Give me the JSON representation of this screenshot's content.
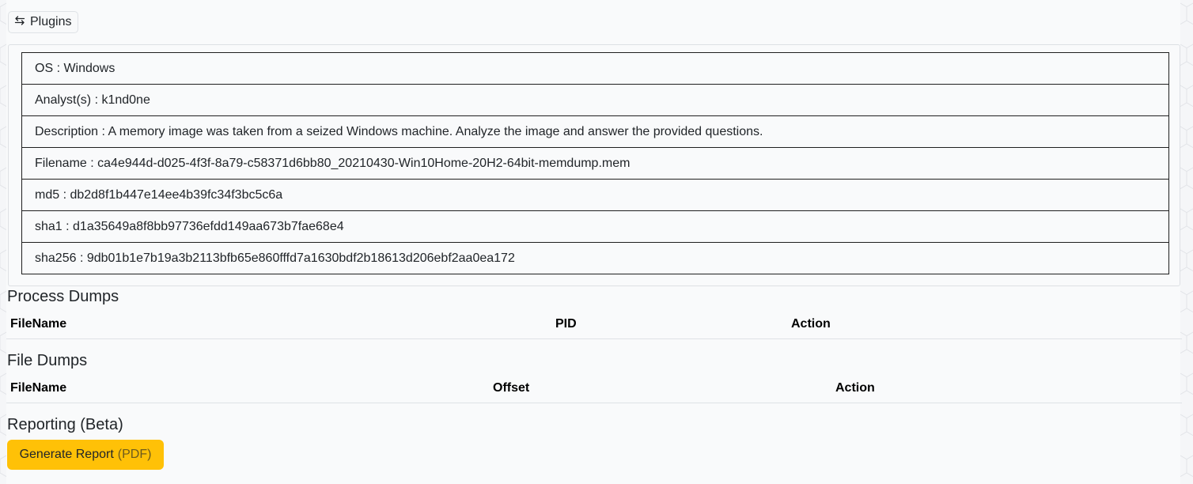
{
  "colors": {
    "page_bg": "#f5f6f8",
    "panel_bg": "#f9fafb",
    "report_button": "#ffc107",
    "table_border": "#1f1f1f"
  },
  "toolbar": {
    "plugins_icon": "swap-arrows-icon",
    "plugins_label": "Plugins"
  },
  "info": {
    "os": "OS : Windows",
    "analysts": "Analyst(s) : k1nd0ne",
    "description": "Description : A memory image was taken from a seized Windows machine. Analyze the image and answer the provided questions.",
    "filename": "Filename : ca4e944d-d025-4f3f-8a79-c58371d6bb80_20210430-Win10Home-20H2-64bit-memdump.mem",
    "md5": "md5 : db2d8f1b447e14ee4b39fc34f3bc5c6a",
    "sha1": "sha1 : d1a35649a8f8bb97736efdd149aa673b7fae68e4",
    "sha256": "sha256 : 9db01b1e7b19a3b2113bfb65e860fffd7a1630bdf2b18613d206ebf2aa0ea172"
  },
  "process_dumps": {
    "title": "Process Dumps",
    "columns": [
      "FileName",
      "PID",
      "Action"
    ]
  },
  "file_dumps": {
    "title": "File Dumps",
    "columns": [
      "FileName",
      "Offset",
      "Action"
    ]
  },
  "reporting": {
    "title": "Reporting (Beta)",
    "button_label": "Generate Report",
    "button_suffix": "(PDF)"
  }
}
